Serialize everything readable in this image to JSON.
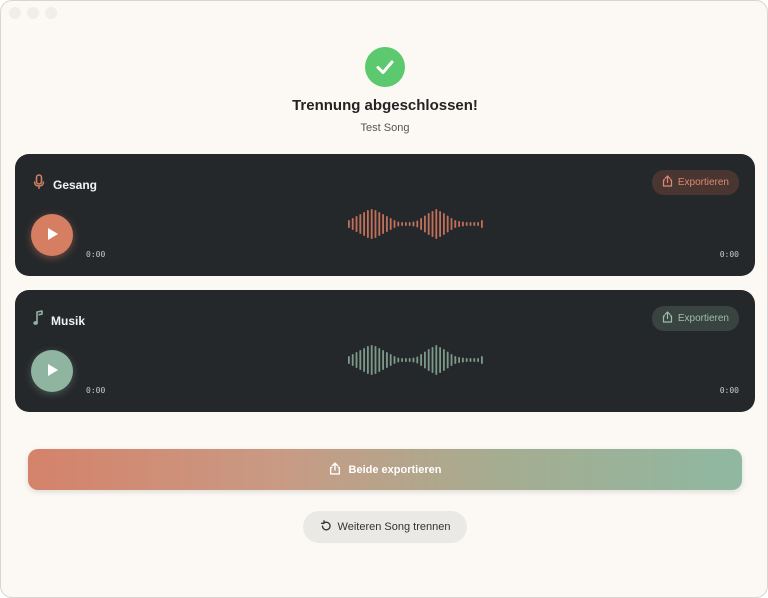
{
  "header": {
    "title": "Trennung abgeschlossen!",
    "song_name": "Test Song"
  },
  "tracks": [
    {
      "name": "Gesang",
      "icon": "microphone-icon",
      "export_label": "Exportieren",
      "time_current": "0:00",
      "time_total": "0:00",
      "accent": "#d67e62"
    },
    {
      "name": "Musik",
      "icon": "music-note-icon",
      "export_label": "Exportieren",
      "time_current": "0:00",
      "time_total": "0:00",
      "accent": "#8fb5a0"
    }
  ],
  "actions": {
    "export_both_label": "Beide exportieren",
    "separate_another_label": "Weiteren Song trennen"
  },
  "colors": {
    "success": "#5cc96e",
    "background": "#fcf9f5",
    "card": "#25282b"
  }
}
